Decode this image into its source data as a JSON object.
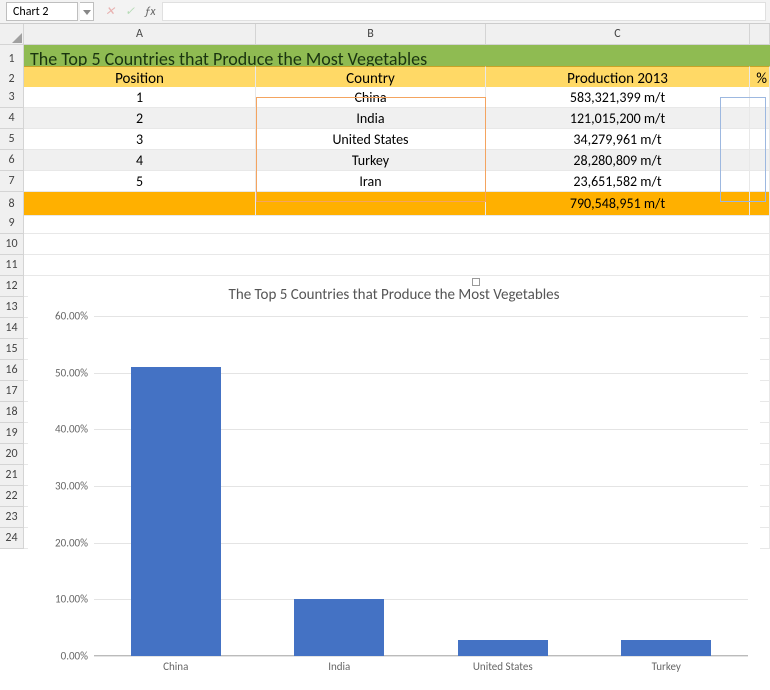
{
  "name_box": "Chart 2",
  "columns": [
    "A",
    "B",
    "C"
  ],
  "rows": [
    "1",
    "2",
    "3",
    "4",
    "5",
    "6",
    "7",
    "8",
    "9",
    "10",
    "11",
    "12",
    "13",
    "14",
    "15",
    "16",
    "17",
    "18",
    "19",
    "20",
    "21",
    "22",
    "23",
    "24"
  ],
  "title": "The Top 5 Countries that Produce the Most Vegetables",
  "headers": {
    "position": "Position",
    "country": "Country",
    "production": "Production 2013",
    "pct": "%"
  },
  "table": [
    {
      "position": "1",
      "country": "China",
      "production": "583,321,399 m/t"
    },
    {
      "position": "2",
      "country": "India",
      "production": "121,015,200 m/t"
    },
    {
      "position": "3",
      "country": "United States",
      "production": "34,279,961 m/t"
    },
    {
      "position": "4",
      "country": "Turkey",
      "production": "28,280,809 m/t"
    },
    {
      "position": "5",
      "country": "Iran",
      "production": "23,651,582 m/t"
    }
  ],
  "total": "790,548,951 m/t",
  "chart_data": {
    "type": "bar",
    "title": "The Top 5 Countries that Produce the Most Vegetables",
    "categories": [
      "China",
      "India",
      "United States",
      "Turkey"
    ],
    "values": [
      51.0,
      10.0,
      2.8,
      2.8
    ],
    "ylabel": "",
    "xlabel": "",
    "ylim": [
      0,
      60
    ],
    "yticks": [
      "0.00%",
      "10.00%",
      "20.00%",
      "30.00%",
      "40.00%",
      "50.00%",
      "60.00%"
    ]
  }
}
